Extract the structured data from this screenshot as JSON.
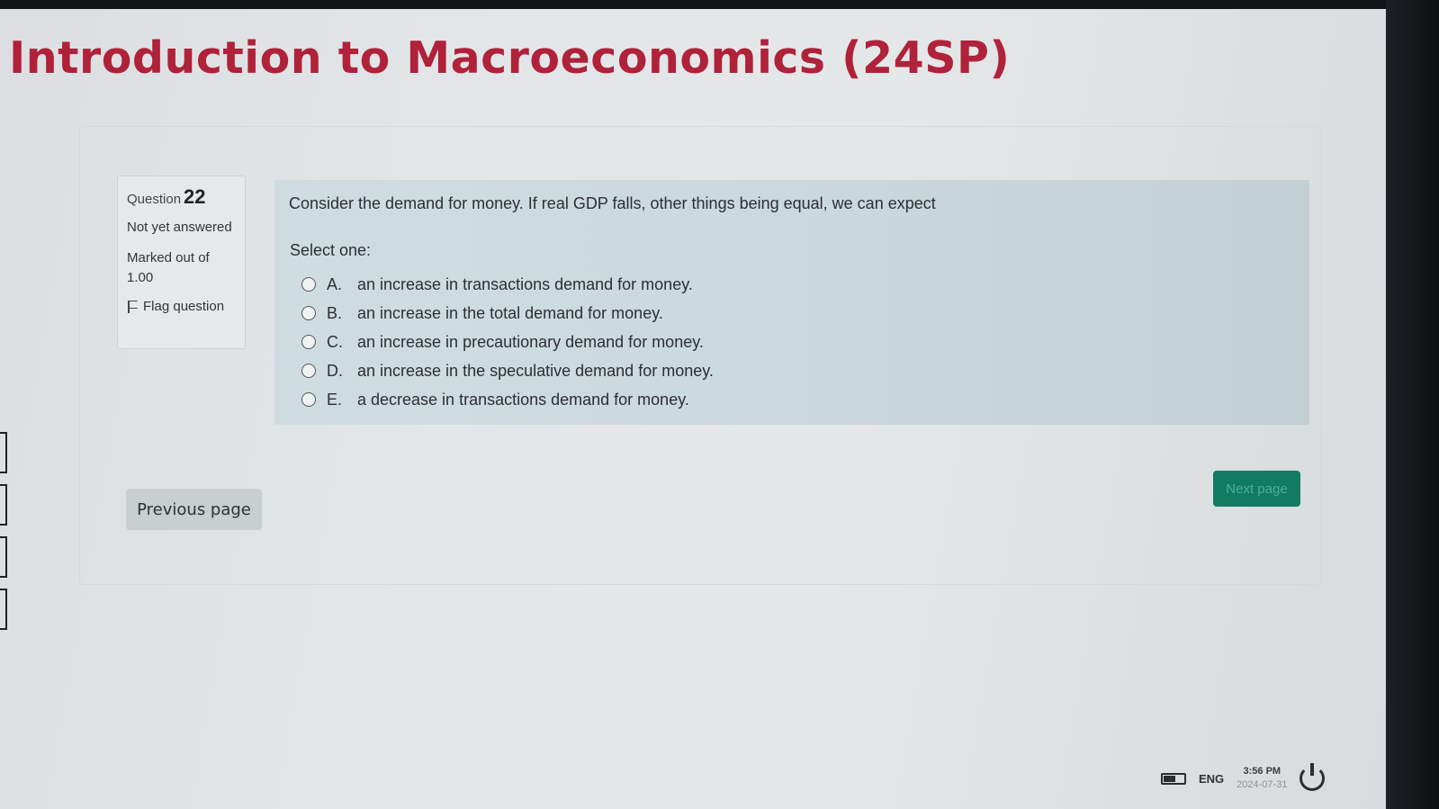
{
  "course": {
    "title": "Introduction to Macroeconomics (24SP)"
  },
  "question_info": {
    "label": "Question",
    "number": "22",
    "state": "Not yet answered",
    "marked": "Marked out of 1.00",
    "flag_label": "Flag question"
  },
  "question": {
    "text": "Consider the demand for money. If real GDP falls, other things being equal, we can expect",
    "prompt": "Select one:",
    "options": [
      {
        "letter": "A.",
        "text": "an increase in transactions demand for money."
      },
      {
        "letter": "B.",
        "text": "an increase in the total demand for money."
      },
      {
        "letter": "C.",
        "text": "an increase in precautionary demand for money."
      },
      {
        "letter": "D.",
        "text": "an increase in the speculative demand for money."
      },
      {
        "letter": "E.",
        "text": "a decrease in transactions demand for money."
      }
    ]
  },
  "nav": {
    "previous_label": "Previous page",
    "next_label": "Next page"
  },
  "taskbar": {
    "language": "ENG",
    "time": "3:56 PM",
    "date": "2024-07-31"
  },
  "colors": {
    "title": "#b0213a",
    "next_button": "#127c63",
    "question_bg": "#cfdde0"
  }
}
